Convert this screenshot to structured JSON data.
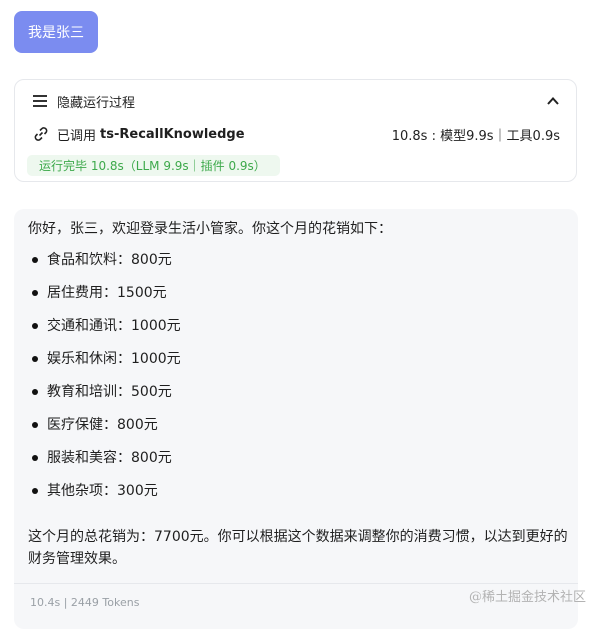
{
  "user_message": "我是张三",
  "run_panel": {
    "toggle_label": "隐藏运行过程",
    "tool_prefix": "已调用",
    "tool_name": "ts-RecallKnowledge",
    "timing": "10.8s : 模型9.9s｜工具0.9s",
    "status": "运行完毕 10.8s（LLM 9.9s｜插件 0.9s）"
  },
  "answer": {
    "intro": "你好，张三，欢迎登录生活小管家。你这个月的花销如下：",
    "items": [
      "食品和饮料：800元",
      "居住费用：1500元",
      "交通和通讯：1000元",
      "娱乐和休闲：1000元",
      "教育和培训：500元",
      "医疗保健：800元",
      "服装和美容：800元",
      "其他杂项：300元"
    ],
    "summary": "这个月的总花销为：7700元。你可以根据这个数据来调整你的消费习惯，以达到更好的财务管理效果。"
  },
  "footer": {
    "stats": "10.4s | 2449 Tokens"
  },
  "watermark": "@稀土掘金技术社区",
  "colors": {
    "accent": "#7b8cf0",
    "success": "#3da94b"
  }
}
